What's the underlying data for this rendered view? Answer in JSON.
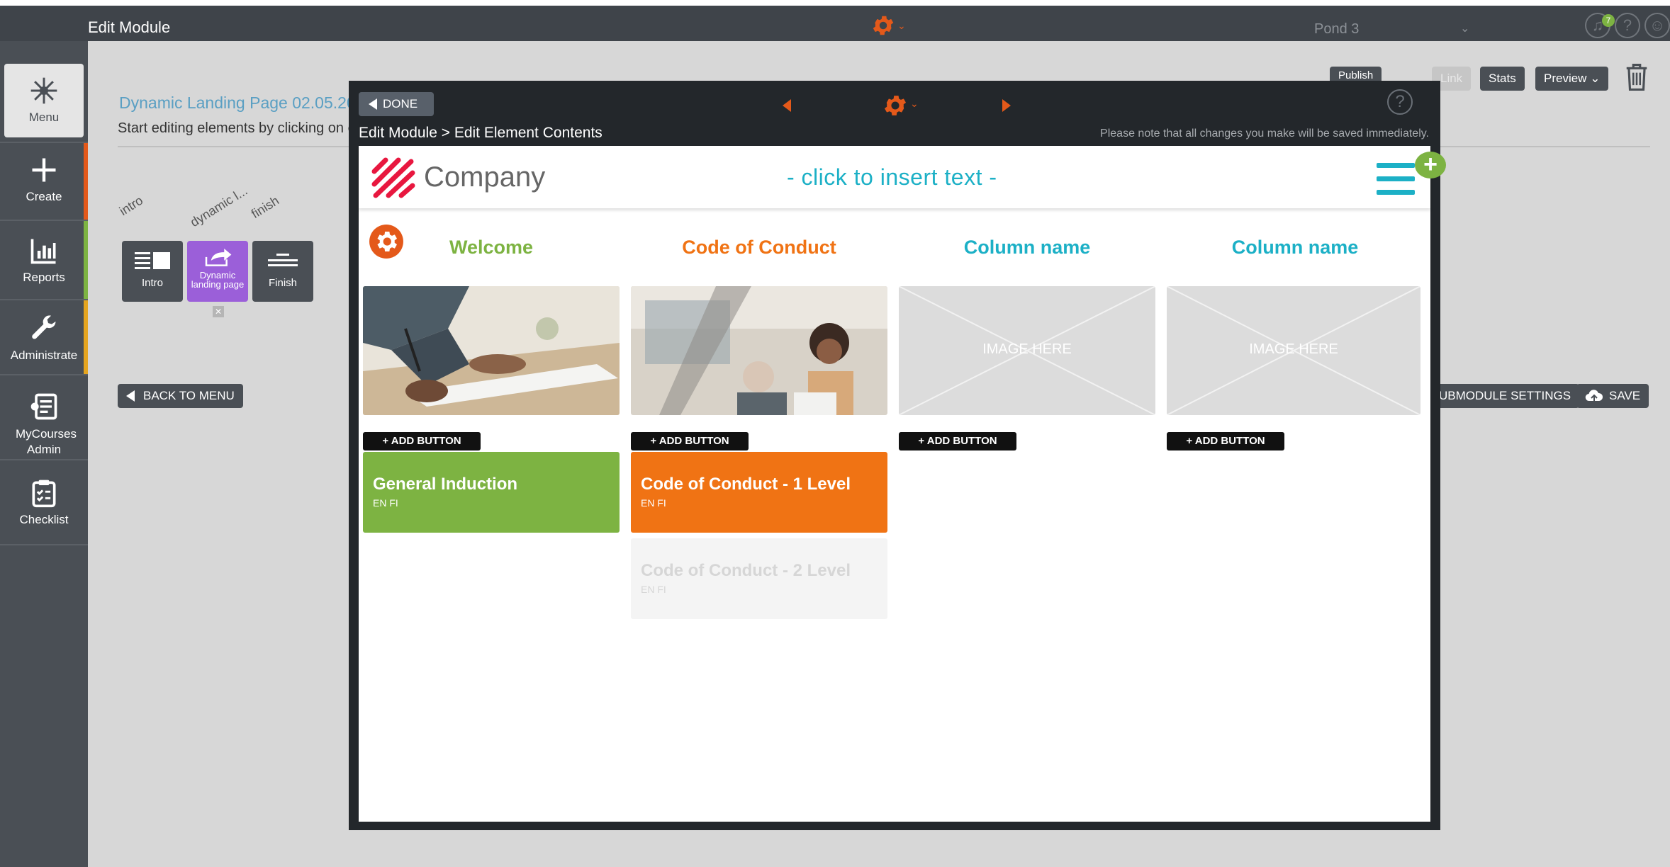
{
  "app": {
    "title": "Edit Module",
    "pond": "Pond 3",
    "notifications_count": "7",
    "help_glyph": "?"
  },
  "sidebar": {
    "items": [
      {
        "label": "Menu",
        "icon": "snowflake-icon"
      },
      {
        "label": "Create",
        "icon": "plus-icon"
      },
      {
        "label": "Reports",
        "icon": "bar-chart-icon"
      },
      {
        "label": "Administrate",
        "icon": "wrench-icon"
      },
      {
        "label": "MyCourses Admin",
        "icon": "courses-icon"
      },
      {
        "label": "Checklist",
        "icon": "clipboard-icon"
      }
    ],
    "accents": [
      "#e4591a",
      "#7db342",
      "#1cb0c6",
      "#e5a520"
    ]
  },
  "background_page": {
    "title": "Dynamic Landing Page 02.05.20",
    "subtitle": "Start editing elements by clicking on c",
    "steps": [
      {
        "rotated_label": "intro",
        "tile_label": "Intro",
        "color": "#4a4f55"
      },
      {
        "rotated_label": "dynamic l...",
        "tile_label": "Dynamic landing page",
        "color": "#9b5fd9"
      },
      {
        "rotated_label": "finish",
        "tile_label": "Finish",
        "color": "#4a4f55"
      }
    ],
    "step_remove_glyph": "✕",
    "buttons": {
      "publish": "Publish",
      "link": "Link",
      "stats": "Stats",
      "preview": "Preview",
      "back_to_menu": "BACK TO MENU",
      "submodule_settings": "UBMODULE SETTINGS",
      "save": "SAVE"
    }
  },
  "modal": {
    "done_label": "DONE",
    "breadcrumb": "Edit Module > Edit Element Contents",
    "save_note": "Please note that all changes you make will be saved immediately.",
    "help_glyph": "?",
    "header": {
      "company": "Company",
      "insert_text": "- click to insert text -",
      "add_glyph": "+"
    },
    "columns": [
      {
        "name": "Welcome",
        "color": "#7db342",
        "image": "photo-signing",
        "add_button": "+ ADD BUTTON",
        "courses": [
          {
            "title": "General Induction",
            "langs": "EN FI",
            "color": "#7db342",
            "dimmed": false
          }
        ]
      },
      {
        "name": "Code of Conduct",
        "color": "#f07314",
        "image": "photo-office",
        "add_button": "+ ADD BUTTON",
        "courses": [
          {
            "title": "Code of Conduct - 1 Level",
            "langs": "EN FI",
            "color": "#f07314",
            "dimmed": false
          },
          {
            "title": "Code of Conduct - 2 Level",
            "langs": "EN FI",
            "color": "#f4f4f4",
            "dimmed": true
          }
        ]
      },
      {
        "name": "Column name",
        "color": "#1cb0c6",
        "image": "placeholder",
        "placeholder_text": "IMAGE HERE",
        "add_button": "+ ADD BUTTON",
        "courses": []
      },
      {
        "name": "Column name",
        "color": "#1cb0c6",
        "image": "placeholder",
        "placeholder_text": "IMAGE HERE",
        "add_button": "+ ADD BUTTON",
        "courses": []
      }
    ]
  },
  "colors": {
    "accent_orange": "#e4591a",
    "teal": "#1cb0c6",
    "green": "#7db342",
    "purple": "#9b5fd9"
  }
}
